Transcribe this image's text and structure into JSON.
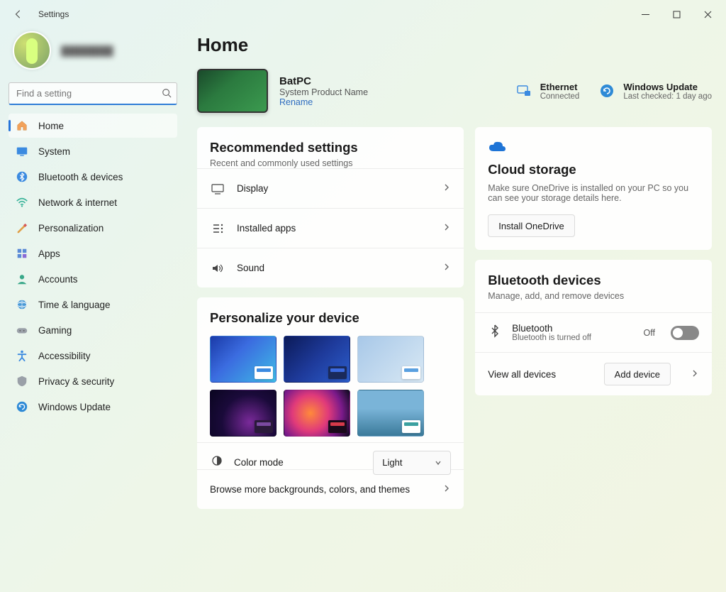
{
  "window": {
    "title": "Settings"
  },
  "search": {
    "placeholder": "Find a setting"
  },
  "sidebar": {
    "items": [
      {
        "label": "Home"
      },
      {
        "label": "System"
      },
      {
        "label": "Bluetooth & devices"
      },
      {
        "label": "Network & internet"
      },
      {
        "label": "Personalization"
      },
      {
        "label": "Apps"
      },
      {
        "label": "Accounts"
      },
      {
        "label": "Time & language"
      },
      {
        "label": "Gaming"
      },
      {
        "label": "Accessibility"
      },
      {
        "label": "Privacy & security"
      },
      {
        "label": "Windows Update"
      }
    ]
  },
  "page": {
    "title": "Home"
  },
  "device": {
    "name": "BatPC",
    "product": "System Product Name",
    "rename": "Rename"
  },
  "status": {
    "ethernet": {
      "title": "Ethernet",
      "sub": "Connected"
    },
    "update": {
      "title": "Windows Update",
      "sub": "Last checked: 1 day ago"
    }
  },
  "recommended": {
    "title": "Recommended settings",
    "desc": "Recent and commonly used settings",
    "items": [
      {
        "label": "Display"
      },
      {
        "label": "Installed apps"
      },
      {
        "label": "Sound"
      }
    ]
  },
  "personalize": {
    "title": "Personalize your device",
    "color_label": "Color mode",
    "color_value": "Light",
    "browse": "Browse more backgrounds, colors, and themes"
  },
  "cloud": {
    "title": "Cloud storage",
    "desc": "Make sure OneDrive is installed on your PC so you can see your storage details here.",
    "button": "Install OneDrive"
  },
  "bluetooth": {
    "title": "Bluetooth devices",
    "desc": "Manage, add, and remove devices",
    "toggle_title": "Bluetooth",
    "toggle_sub": "Bluetooth is turned off",
    "toggle_state": "Off",
    "view_all": "View all devices",
    "add": "Add device"
  }
}
